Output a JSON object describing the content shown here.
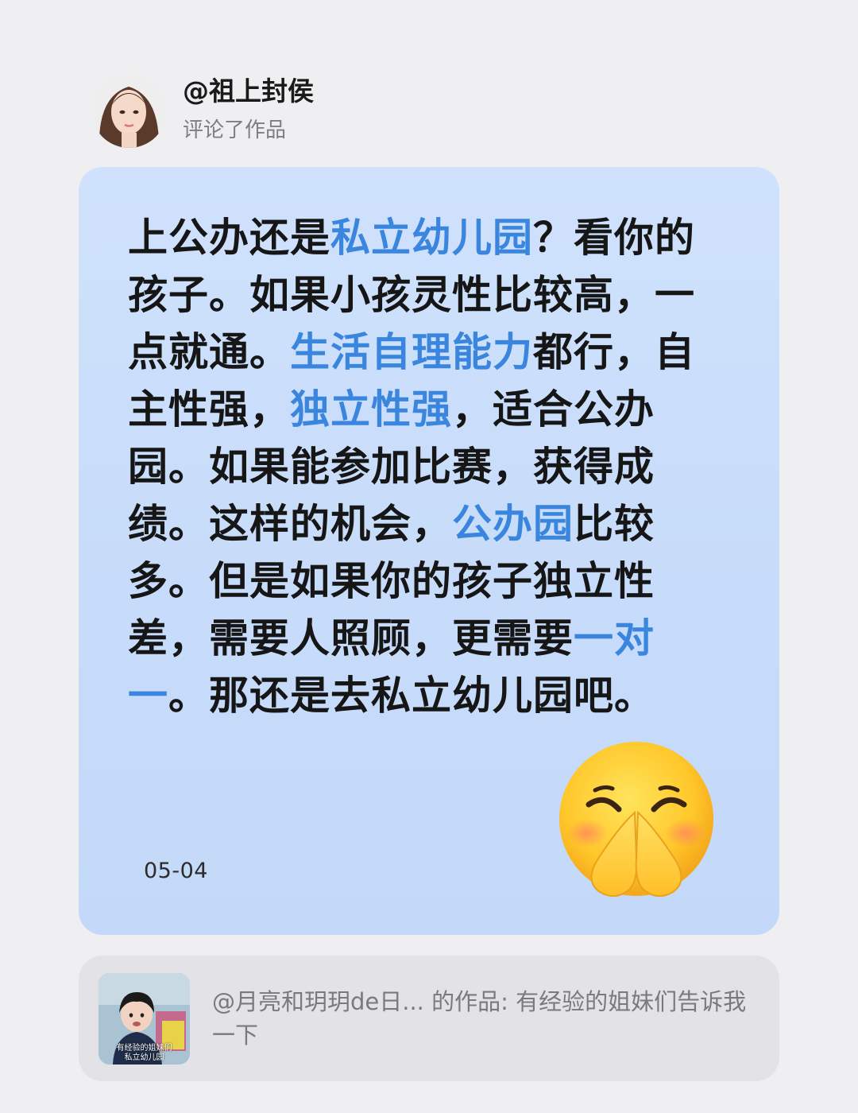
{
  "header": {
    "username": "@祖上封侯",
    "action": "评论了作品"
  },
  "comment": {
    "segments": [
      {
        "text": "上公办还是",
        "highlight": false
      },
      {
        "text": "私立幼儿园",
        "highlight": true
      },
      {
        "text": "？看你的孩子。如果小孩灵性比较高，一点就通。",
        "highlight": false
      },
      {
        "text": "生活自理能力",
        "highlight": true
      },
      {
        "text": "都行，自主性强，",
        "highlight": false
      },
      {
        "text": "独立性强",
        "highlight": true
      },
      {
        "text": "，适合公办园。如果能参加比赛，获得成绩。这样的机会，",
        "highlight": false
      },
      {
        "text": "公办园",
        "highlight": true
      },
      {
        "text": "比较多。但是如果你的孩子独立性差，需要人照顾，更需要",
        "highlight": false
      },
      {
        "text": "一对一",
        "highlight": true
      },
      {
        "text": "。那还是去私立幼儿园吧。",
        "highlight": false
      }
    ],
    "date": "05-04",
    "emoji": "pleading-hands-emoji"
  },
  "work_reference": {
    "text": "@月亮和玥玥de日... 的作品: 有经验的姐妹们告诉我一下",
    "thumbnail_caption_line1": "有经验的姐妹们",
    "thumbnail_caption_line2": "私立幼儿园"
  },
  "colors": {
    "highlight": "#3a86de",
    "card_bg": "#cfe1fc",
    "page_bg": "#efeef1",
    "ref_bg": "#e3e2e6"
  }
}
